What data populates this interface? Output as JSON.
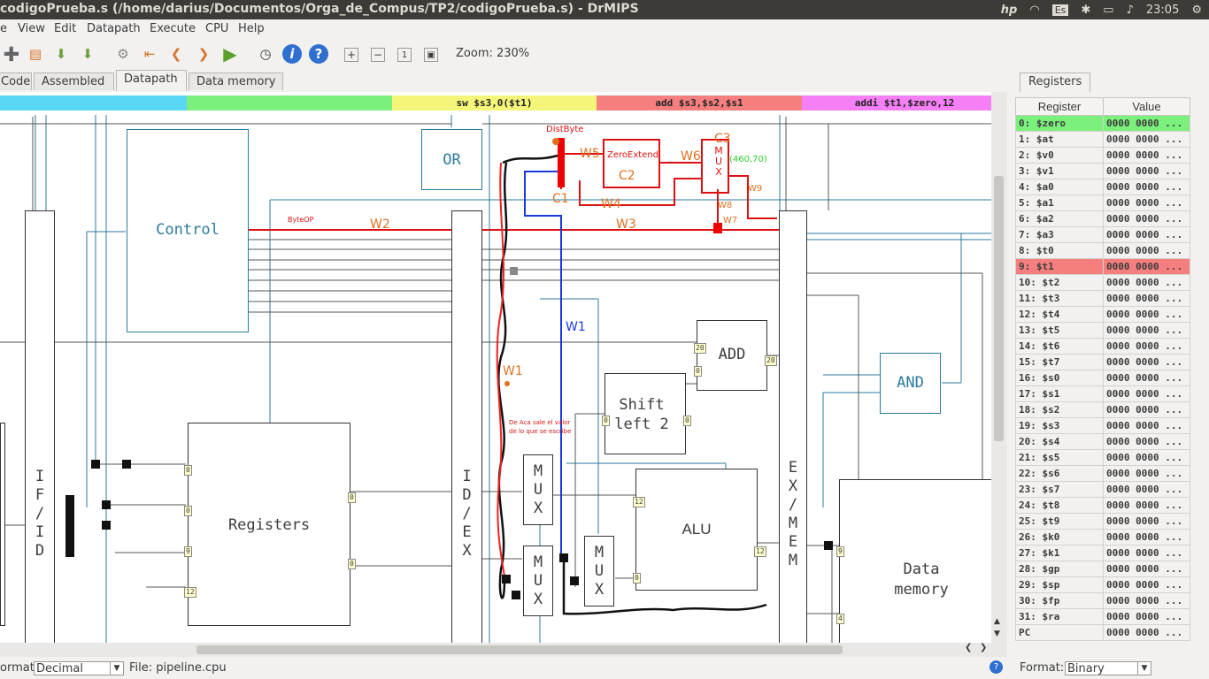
{
  "window": {
    "title": "codigoPrueba.s (/home/darius/Documentos/Orga_de_Compus/TP2/codigoPrueba.s) - DrMIPS"
  },
  "tray": {
    "brand": "hp",
    "keyboard": "Es",
    "time": "23:05"
  },
  "menu": [
    "e",
    "View",
    "Edit",
    "Datapath",
    "Execute",
    "CPU",
    "Help"
  ],
  "toolbar": {
    "zoom_label": "Zoom: 230%"
  },
  "tabs": [
    "Code",
    "Assembled",
    "Datapath",
    "Data memory"
  ],
  "active_tab": "Datapath",
  "stages": [
    {
      "text": "",
      "color": "#5ad7f5"
    },
    {
      "text": "",
      "color": "#7cf07c"
    },
    {
      "text": "sw $s3,0($t1)",
      "color": "#f5f57a"
    },
    {
      "text": "add $s3,$s2,$s1",
      "color": "#f57f7f"
    },
    {
      "text": "addi $t1,$zero,12",
      "color": "#f57ff5"
    }
  ],
  "datapath": {
    "control": "Control",
    "or": "OR",
    "registers": "Registers",
    "if_id": [
      "I",
      "F",
      "/",
      "I",
      "D"
    ],
    "id_ex": [
      "I",
      "D",
      "/",
      "E",
      "X"
    ],
    "ex_mem": [
      "E",
      "X",
      "/",
      "M",
      "E",
      "M"
    ],
    "mux": [
      "M",
      "U",
      "X"
    ],
    "alu": "ALU",
    "add": "ADD",
    "shift": [
      "Shift",
      "left 2"
    ],
    "and": "AND",
    "data_memory": [
      "Data",
      "memory"
    ],
    "zero_extend": "ZeroExtend",
    "ports": [
      "0",
      "0",
      "9",
      "12",
      "0",
      "0",
      "20",
      "0",
      "20",
      "0",
      "0",
      "12",
      "0",
      "12",
      "9",
      "4"
    ],
    "annotations": {
      "distbyte": "DistByte",
      "byteop": "ByteOP",
      "w1": "W1",
      "w2": "W2",
      "w3": "W3",
      "w4": "W4",
      "w5": "W5",
      "w6": "W6",
      "w7": "W7",
      "w8": "W8",
      "w9": "W9",
      "c1": "C1",
      "c2": "C2",
      "c3": "C3",
      "coord": "(460,70)",
      "note": [
        "De Aca sale el valor",
        "de lo que se escribe"
      ]
    }
  },
  "status": {
    "format_label": "ormat:",
    "format_value": "Decimal",
    "file_label": "File: pipeline.cpu"
  },
  "registers_panel": {
    "tab": "Registers",
    "headers": [
      "Register",
      "Value"
    ],
    "rows": [
      [
        "0: $zero",
        "0000 0000 ..."
      ],
      [
        "1: $at",
        "0000 0000 ..."
      ],
      [
        "2: $v0",
        "0000 0000 ..."
      ],
      [
        "3: $v1",
        "0000 0000 ..."
      ],
      [
        "4: $a0",
        "0000 0000 ..."
      ],
      [
        "5: $a1",
        "0000 0000 ..."
      ],
      [
        "6: $a2",
        "0000 0000 ..."
      ],
      [
        "7: $a3",
        "0000 0000 ..."
      ],
      [
        "8: $t0",
        "0000 0000 ..."
      ],
      [
        "9: $t1",
        "0000 0000 ..."
      ],
      [
        "10: $t2",
        "0000 0000 ..."
      ],
      [
        "11: $t3",
        "0000 0000 ..."
      ],
      [
        "12: $t4",
        "0000 0000 ..."
      ],
      [
        "13: $t5",
        "0000 0000 ..."
      ],
      [
        "14: $t6",
        "0000 0000 ..."
      ],
      [
        "15: $t7",
        "0000 0000 ..."
      ],
      [
        "16: $s0",
        "0000 0000 ..."
      ],
      [
        "17: $s1",
        "0000 0000 ..."
      ],
      [
        "18: $s2",
        "0000 0000 ..."
      ],
      [
        "19: $s3",
        "0000 0000 ..."
      ],
      [
        "20: $s4",
        "0000 0000 ..."
      ],
      [
        "21: $s5",
        "0000 0000 ..."
      ],
      [
        "22: $s6",
        "0000 0000 ..."
      ],
      [
        "23: $s7",
        "0000 0000 ..."
      ],
      [
        "24: $t8",
        "0000 0000 ..."
      ],
      [
        "25: $t9",
        "0000 0000 ..."
      ],
      [
        "26: $k0",
        "0000 0000 ..."
      ],
      [
        "27: $k1",
        "0000 0000 ..."
      ],
      [
        "28: $gp",
        "0000 0000 ..."
      ],
      [
        "29: $sp",
        "0000 0000 ..."
      ],
      [
        "30: $fp",
        "0000 0000 ..."
      ],
      [
        "31: $ra",
        "0000 0000 ..."
      ],
      [
        "PC",
        "0000 0000 ..."
      ]
    ],
    "highlight": {
      "0": "#7cf07c",
      "9": "#f57f7f"
    },
    "format_label": "Format:",
    "format_value": "Binary"
  }
}
